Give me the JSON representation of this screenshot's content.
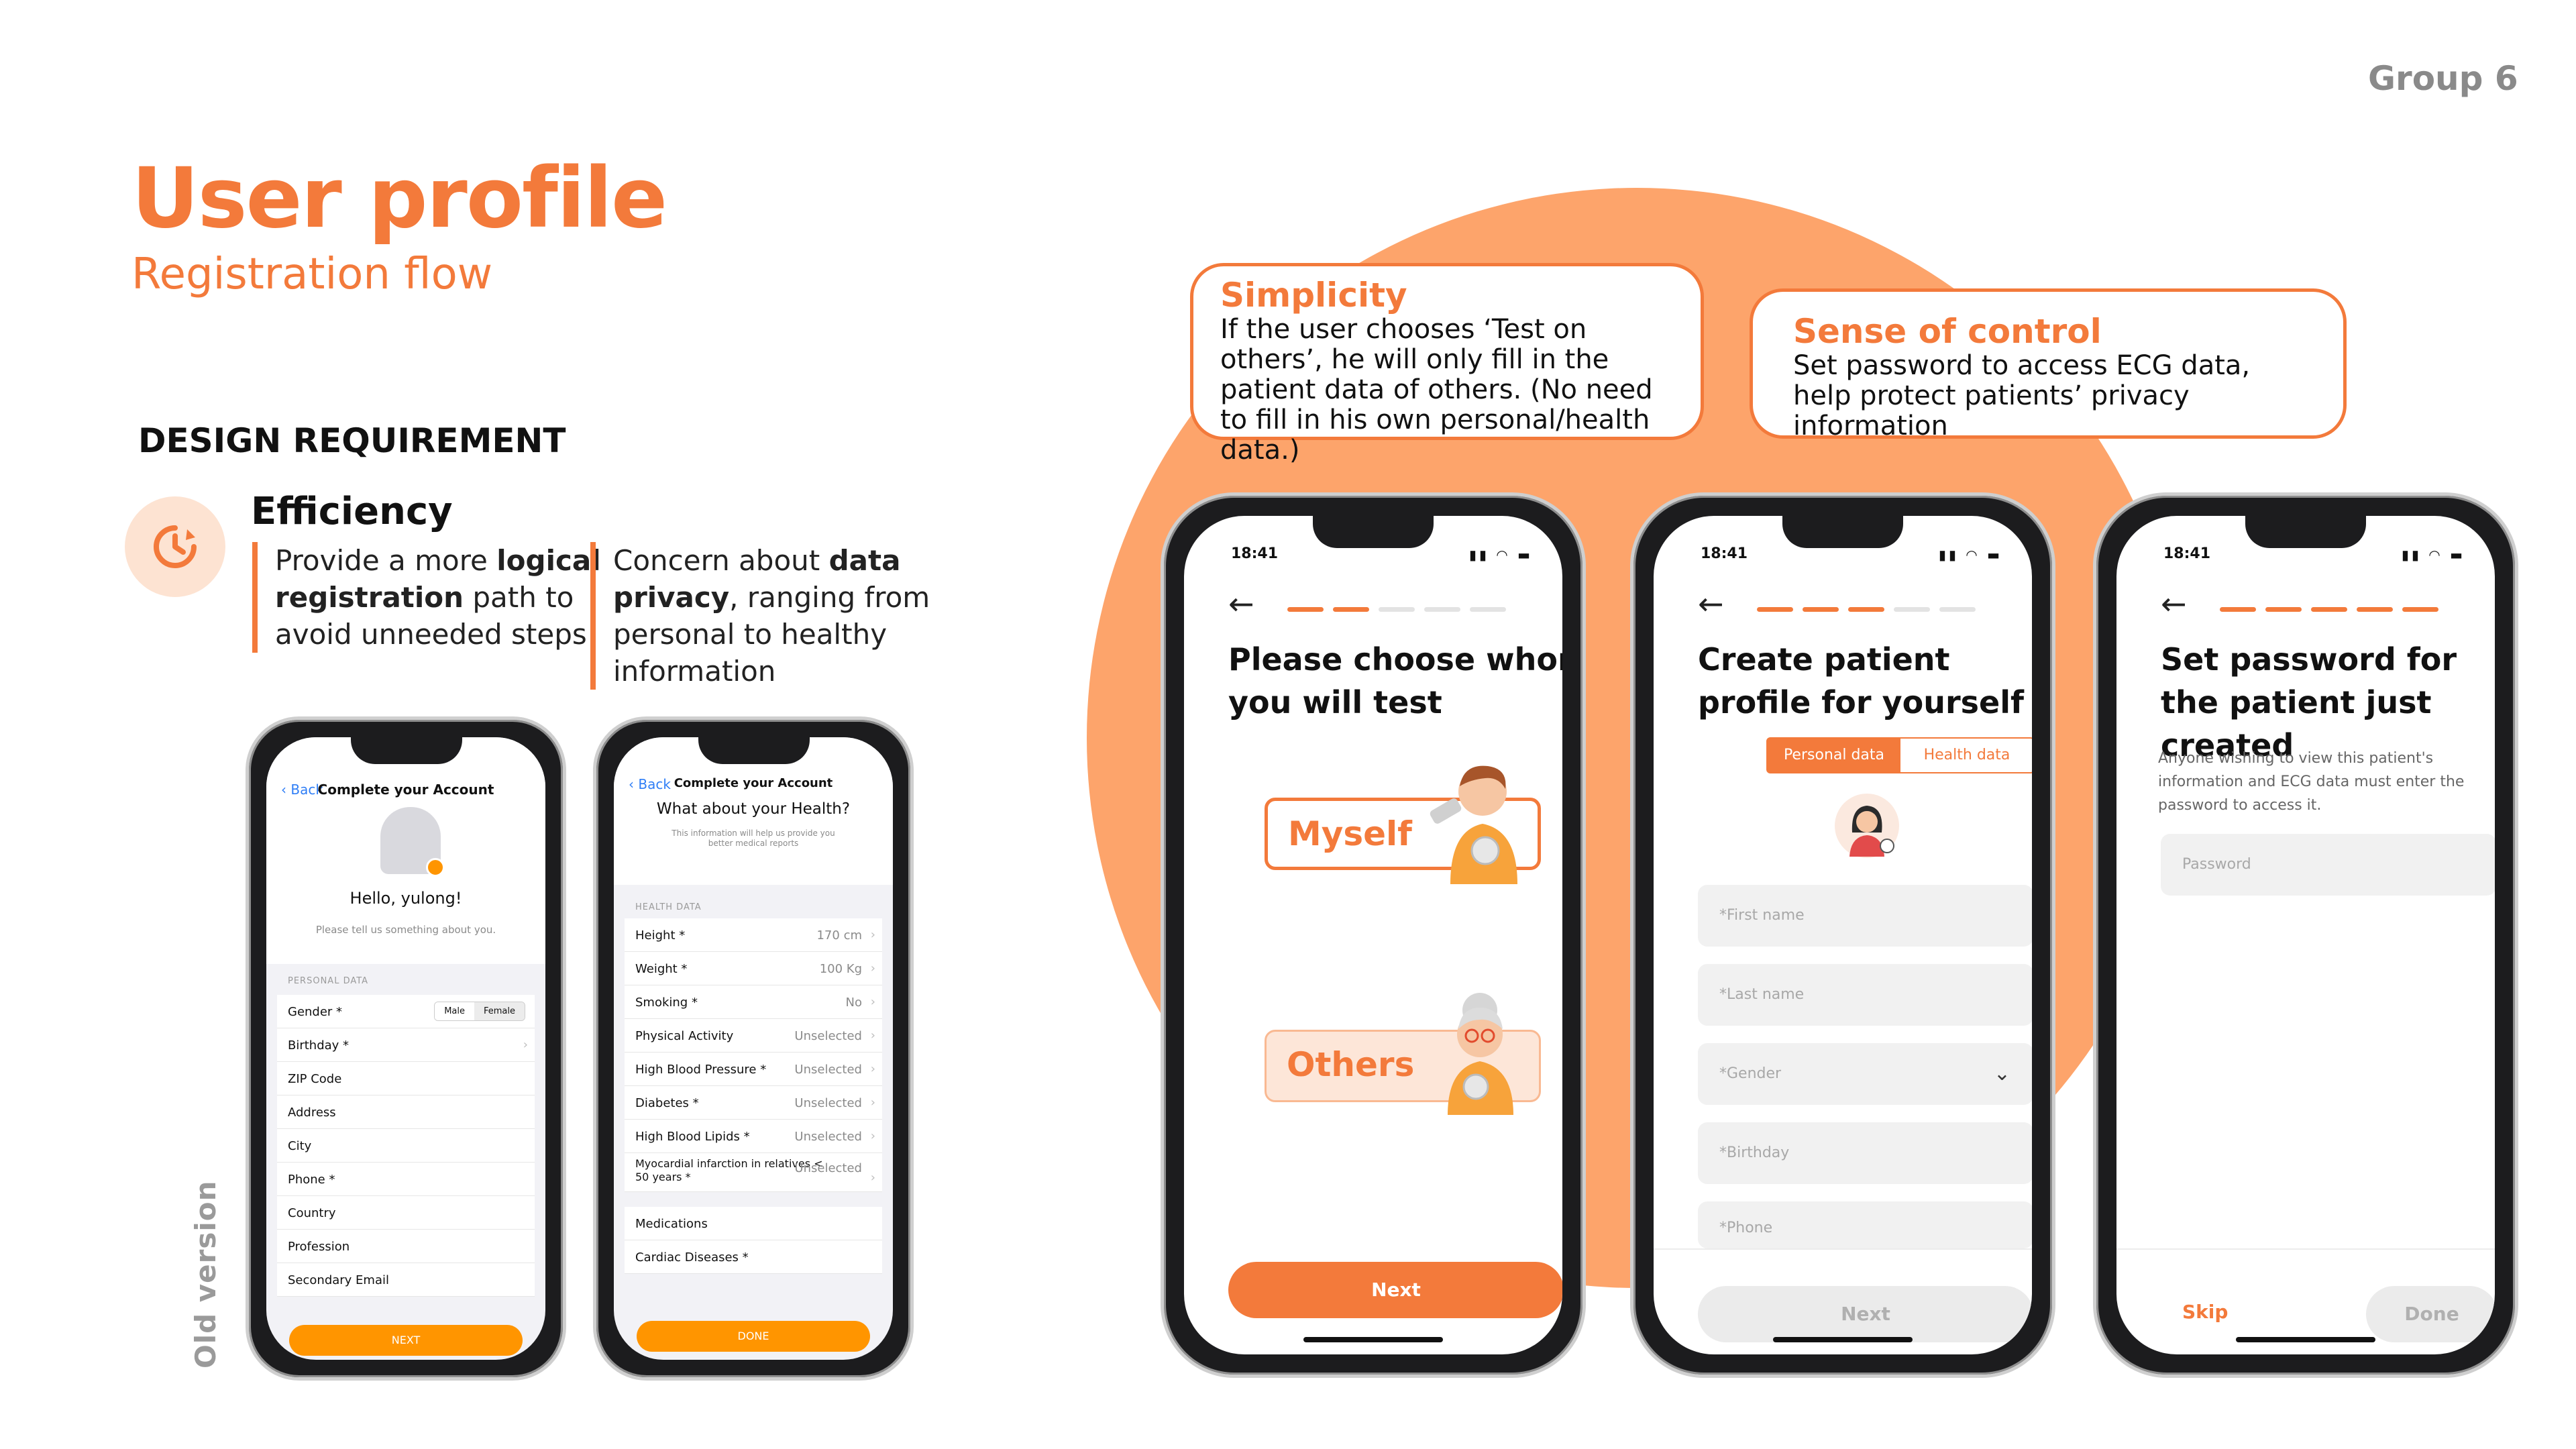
{
  "slide": {
    "group": "Group 6",
    "title": "User profile",
    "subtitle": "Registration flow",
    "requirement_heading": "DESIGN REQUIREMENT",
    "efficiency": {
      "title": "Efficiency",
      "bullet1": {
        "pre": "Provide a more ",
        "bold1": "logical registration",
        "post": " path to avoid unneeded steps"
      },
      "bullet2": {
        "pre": "Concern about ",
        "bold1": "data privacy",
        "post": ", ranging from personal to healthy information"
      }
    },
    "old_version_label": "Old version",
    "callouts": {
      "simplicity": {
        "title": "Simplicity",
        "text": "If the user chooses ‘Test on others’, he will only fill in the patient data of others. (No need to fill in his own personal/health data.)"
      },
      "control": {
        "title": "Sense of control",
        "text": "Set password to access ECG data, help protect patients’ privacy information"
      }
    },
    "colors": {
      "accent": "#f37a3b",
      "circle": "#fda46b",
      "ios_orange": "#ff9500",
      "ios_blue": "#2f7ef6"
    }
  },
  "old_phone1": {
    "back": "Back",
    "header": "Complete your Account",
    "greeting": "Hello, yulong!",
    "hint": "Please tell us something about you.",
    "section": "PERSONAL DATA",
    "gender_label": "Gender *",
    "gender_options": [
      "Male",
      "Female"
    ],
    "rows": [
      "Birthday *",
      "ZIP Code",
      "Address",
      "City",
      "Phone *",
      "Country",
      "Profession",
      "Secondary Email"
    ],
    "button": "NEXT"
  },
  "old_phone2": {
    "back": "Back",
    "header": "Complete your Account",
    "title": "What about your Health?",
    "hint": "This information will help us provide you better medical reports",
    "section": "HEALTH DATA",
    "rows": [
      {
        "label": "Height *",
        "value": "170 cm"
      },
      {
        "label": "Weight *",
        "value": "100 Kg"
      },
      {
        "label": "Smoking *",
        "value": "No"
      },
      {
        "label": "Physical Activity",
        "value": "Unselected"
      },
      {
        "label": "High Blood Pressure *",
        "value": "Unselected"
      },
      {
        "label": "Diabetes *",
        "value": "Unselected"
      },
      {
        "label": "High Blood Lipids *",
        "value": "Unselected"
      },
      {
        "label": "Myocardial infarction in relatives < 50 years *",
        "value": "Unselected"
      }
    ],
    "rows2": [
      "Medications",
      "Cardiac Diseases *"
    ],
    "button": "DONE"
  },
  "phone_a": {
    "time": "18:41",
    "progress_on": 2,
    "progress_total": 5,
    "title": "Please choose whom you will test",
    "option1": "Myself",
    "option2": "Others",
    "button": "Next"
  },
  "phone_b": {
    "time": "18:41",
    "progress_on": 3,
    "progress_total": 5,
    "title": "Create patient profile for yourself",
    "tab_active": "Personal data",
    "tab_inactive": "Health data",
    "fields": [
      "*First name",
      "*Last name",
      "*Gender",
      "*Birthday",
      "*Phone"
    ],
    "button": "Next"
  },
  "phone_c": {
    "time": "18:41",
    "progress_on": 5,
    "progress_total": 5,
    "title": "Set password for the patient just created",
    "desc": "Anyone wishing to view this patient's information and ECG data must enter the password to access it.",
    "field": "Password",
    "skip": "Skip",
    "done": "Done"
  }
}
